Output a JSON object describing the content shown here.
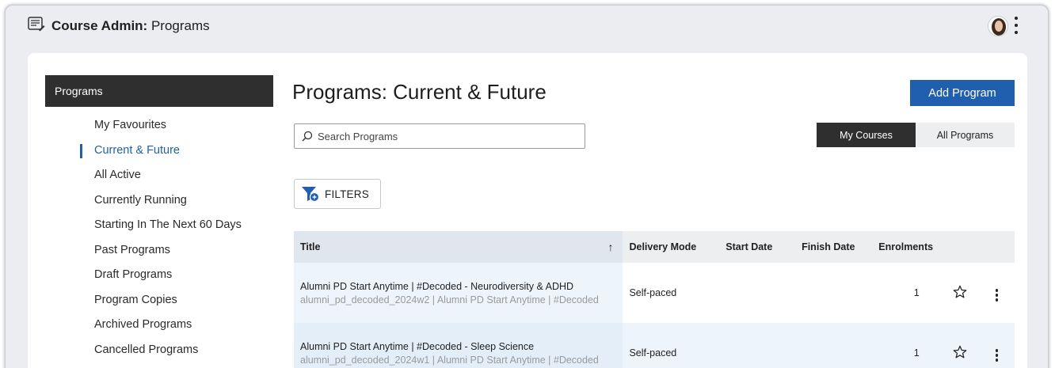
{
  "app": {
    "title_bold": "Course Admin:",
    "title_rest": " Programs"
  },
  "sidebar": {
    "header": "Programs",
    "items": [
      {
        "label": "My Favourites",
        "active": false
      },
      {
        "label": "Current & Future",
        "active": true
      },
      {
        "label": "All Active",
        "active": false
      },
      {
        "label": "Currently Running",
        "active": false
      },
      {
        "label": "Starting In The Next 60 Days",
        "active": false
      },
      {
        "label": "Past Programs",
        "active": false
      },
      {
        "label": "Draft Programs",
        "active": false
      },
      {
        "label": "Program Copies",
        "active": false
      },
      {
        "label": "Archived Programs",
        "active": false
      },
      {
        "label": "Cancelled Programs",
        "active": false
      }
    ]
  },
  "main": {
    "page_title": "Programs: Current & Future",
    "add_button": "Add Program",
    "search": {
      "placeholder": "Search Programs",
      "value": ""
    },
    "toggle": {
      "options": [
        "My Courses",
        "All Programs"
      ],
      "selected": "My Courses"
    },
    "filters_label": "FILTERS"
  },
  "table": {
    "columns": [
      "Title",
      "Delivery Mode",
      "Start Date",
      "Finish Date",
      "Enrolments"
    ],
    "sort_arrow": "↑",
    "rows": [
      {
        "title": "Alumni PD Start Anytime | #Decoded - Neurodiversity & ADHD",
        "subtitle": "alumni_pd_decoded_2024w2 | Alumni PD Start Anytime | #Decoded",
        "delivery_mode": "Self-paced",
        "start_date": "",
        "finish_date": "",
        "enrolments": "1"
      },
      {
        "title": "Alumni PD Start Anytime | #Decoded - Sleep Science",
        "subtitle": "alumni_pd_decoded_2024w1 | Alumni PD Start Anytime | #Decoded",
        "delivery_mode": "Self-paced",
        "start_date": "",
        "finish_date": "",
        "enrolments": "1"
      }
    ]
  },
  "colors": {
    "accent": "#1f5fad",
    "dark": "#2f2f2f",
    "background": "#ebedf0"
  }
}
